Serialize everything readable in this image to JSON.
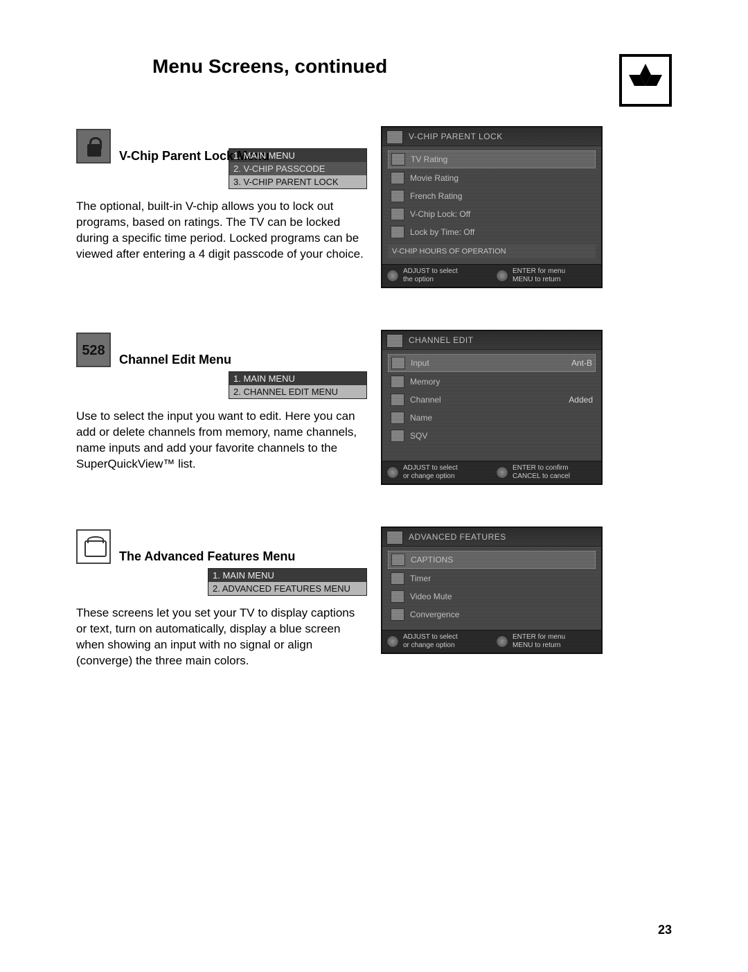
{
  "page": {
    "title": "Menu Screens, continued",
    "number": "23"
  },
  "sections": {
    "vchip": {
      "icon_glyph": "🔒",
      "heading": "V-Chip Parent Lock Menu",
      "breadcrumb": {
        "l1": "1. MAIN MENU",
        "l2": "2. V-CHIP PASSCODE",
        "l3": "3. V-CHIP PARENT LOCK"
      },
      "body": "The optional, built-in V-chip allows you to lock out programs, based on ratings. The TV can be locked during a specific time period. Locked programs can be viewed after entering a 4 digit passcode of your choice.",
      "tv": {
        "header": "V-CHIP PARENT LOCK",
        "rows": [
          {
            "label": "TV Rating",
            "selected": true
          },
          {
            "label": "Movie Rating"
          },
          {
            "label": "French Rating"
          },
          {
            "label": "V-Chip Lock: Off"
          },
          {
            "label": "Lock by Time: Off"
          }
        ],
        "subhead": "V-CHIP HOURS OF OPERATION",
        "footer": {
          "left_a": "ADJUST  to select",
          "left_b": "the option",
          "right_a": "ENTER for menu",
          "right_b": "MENU to return"
        }
      }
    },
    "channel": {
      "icon_glyph": "528",
      "heading": "Channel Edit Menu",
      "breadcrumb": {
        "l1": "1. MAIN MENU",
        "l2": "2. CHANNEL EDIT MENU"
      },
      "body": "Use to select the input you want to edit. Here you can add or delete channels from memory, name channels, name inputs and add your favorite channels to the SuperQuickView™ list.",
      "tv": {
        "header": "CHANNEL EDIT",
        "rows": [
          {
            "label": "Input",
            "value": "Ant-B",
            "selected": true
          },
          {
            "label": "Memory"
          },
          {
            "label": "Channel",
            "value": "Added"
          },
          {
            "label": "Name"
          },
          {
            "label": "SQV"
          }
        ],
        "footer": {
          "left_a": "ADJUST  to select",
          "left_b": "or change option",
          "right_a": "ENTER to confirm",
          "right_b": "CANCEL to cancel"
        }
      }
    },
    "advanced": {
      "icon_glyph": "",
      "heading": "The Advanced Features Menu",
      "breadcrumb": {
        "l1": "1. MAIN MENU",
        "l2": "2. ADVANCED FEATURES MENU"
      },
      "body": "These screens let you set your TV to display captions or text, turn on automatically, display a blue screen when showing an input with no signal or align (converge) the three main colors.",
      "tv": {
        "header": "ADVANCED FEATURES",
        "rows": [
          {
            "label": "CAPTIONS",
            "selected": true
          },
          {
            "label": "Timer"
          },
          {
            "label": "Video Mute"
          },
          {
            "label": "Convergence"
          }
        ],
        "footer": {
          "left_a": "ADJUST  to select",
          "left_b": "or change option",
          "right_a": "ENTER for menu",
          "right_b": "MENU to return"
        }
      }
    }
  }
}
